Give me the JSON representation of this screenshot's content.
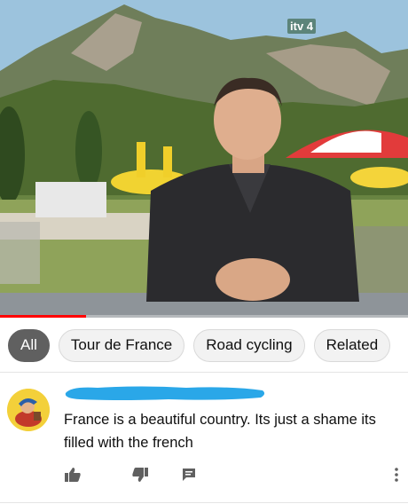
{
  "video": {
    "channel_logo": "itv 4",
    "progress_fraction": 0.21
  },
  "chips": [
    {
      "label": "All",
      "active": true
    },
    {
      "label": "Tour de France",
      "active": false
    },
    {
      "label": "Road cycling",
      "active": false
    },
    {
      "label": "Related",
      "active": false
    }
  ],
  "comment": {
    "author": "",
    "text": "France is a beautiful country. Its just a shame its filled with the french",
    "icons": {
      "like": "thumbs-up-icon",
      "dislike": "thumbs-down-icon",
      "reply": "reply-icon",
      "more": "more-vert-icon"
    }
  },
  "colors": {
    "accent_red": "#ff0000",
    "redaction_blue": "#2aa7e8",
    "chip_active": "#606060",
    "chip_inactive": "#f2f2f2"
  }
}
